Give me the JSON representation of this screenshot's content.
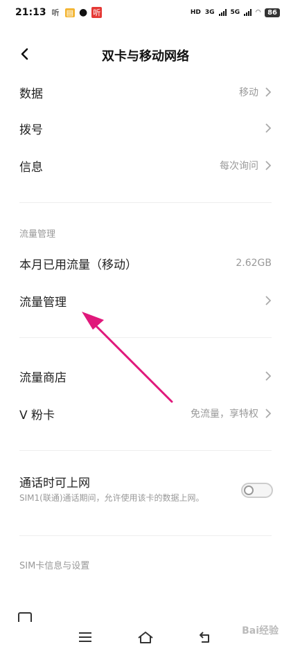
{
  "status_bar": {
    "time": "21:13",
    "app_badge_1": "听",
    "app_badge_2": "听",
    "net1": "3G",
    "net2": "5G",
    "hd": "HD",
    "battery": "86"
  },
  "header": {
    "title": "双卡与移动网络"
  },
  "rows_top": [
    {
      "title": "数据",
      "value": "移动"
    },
    {
      "title": "拨号",
      "value": ""
    },
    {
      "title": "信息",
      "value": "每次询问"
    }
  ],
  "traffic_section": {
    "label": "流量管理",
    "usage_title": "本月已用流量（移动）",
    "usage_value": "2.62GB",
    "manage_title": "流量管理"
  },
  "rows_mid": [
    {
      "title": "流量商店",
      "value": ""
    },
    {
      "title": "V 粉卡",
      "value": "免流量，享特权"
    }
  ],
  "call_data": {
    "title": "通话时可上网",
    "desc": "SIM1(联通)通话期间，允许使用该卡的数据上网。",
    "enabled": false
  },
  "sim_section": {
    "label": "SIM卡信息与设置"
  },
  "watermark": "Bai经验",
  "colors": {
    "arrow": "#e0187b",
    "muted": "#999999"
  }
}
